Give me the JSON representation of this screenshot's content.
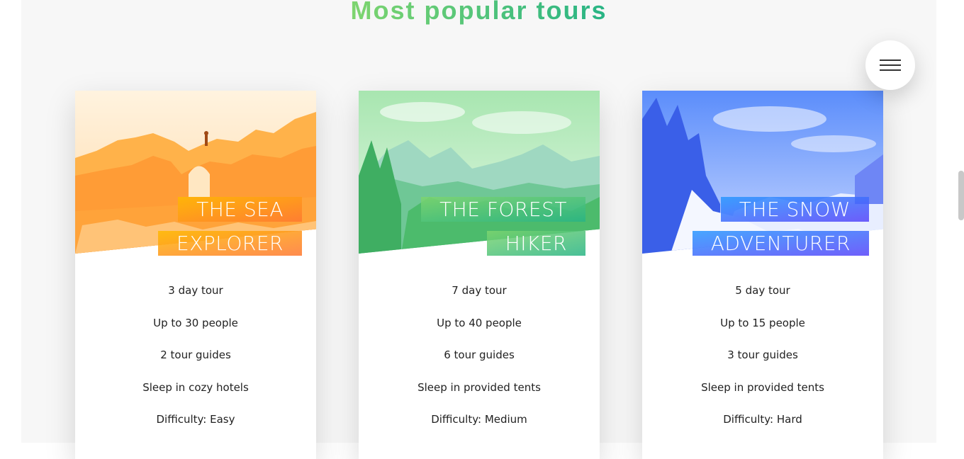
{
  "section": {
    "title": "Most popular tours"
  },
  "menu_button": {
    "icon": "menu-icon"
  },
  "tours": [
    {
      "title_line1": "THE SEA",
      "title_line2": "EXPLORER",
      "duration": "3 day tour",
      "capacity": "Up to 30 people",
      "guides": "2 tour guides",
      "lodging": "Sleep in cozy hotels",
      "difficulty": "Difficulty: Easy"
    },
    {
      "title_line1": "THE FOREST",
      "title_line2": "HIKER",
      "duration": "7 day tour",
      "capacity": "Up to 40 people",
      "guides": "6 tour guides",
      "lodging": "Sleep in provided tents",
      "difficulty": "Difficulty: Medium"
    },
    {
      "title_line1": "THE SNOW",
      "title_line2": "ADVENTURER",
      "duration": "5 day tour",
      "capacity": "Up to 15 people",
      "guides": "3 tour guides",
      "lodging": "Sleep in provided tents",
      "difficulty": "Difficulty: Hard"
    }
  ],
  "colors": {
    "heading_from": "#7ed56f",
    "heading_to": "#28b485",
    "orange_from": "#ffb900",
    "orange_to": "#ff7730",
    "green_from": "#7ed56f",
    "green_to": "#28b485",
    "blue_from": "#2998ff",
    "blue_to": "#5643fa"
  }
}
